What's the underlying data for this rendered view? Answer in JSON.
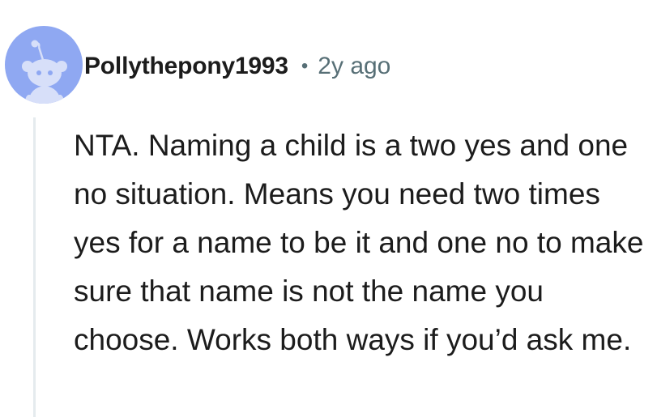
{
  "comment": {
    "author": "Pollythepony1993",
    "separator": "•",
    "timestamp": "2y ago",
    "body": "NTA. Naming a child is a two yes and one no situation. Means you need two times yes for a name to be it and one no to make sure that name is not the name you choose. Works both ways if you’d ask me."
  },
  "avatar": {
    "icon": "snoo-avatar-icon",
    "background_color": "#8fa8f2",
    "figure_color": "#d7dff9"
  },
  "colors": {
    "text": "#1c1c1c",
    "meta": "#576f76",
    "thread_line": "#e5ebee"
  }
}
